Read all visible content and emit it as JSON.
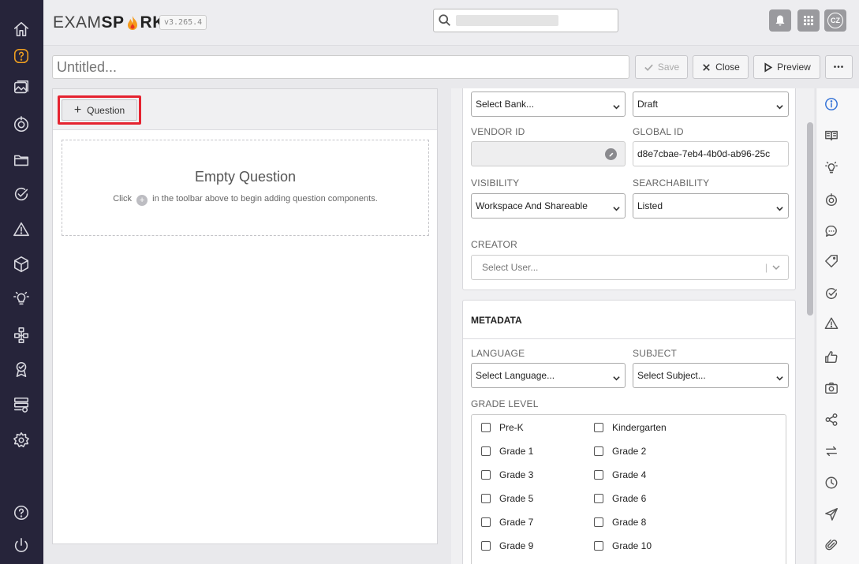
{
  "app": {
    "logo_left": "EXAM",
    "logo_bold_a": "SP",
    "logo_bold_b": "RK",
    "version": "v3.265.4",
    "user_initials": "CZ"
  },
  "search": {
    "placeholder": ""
  },
  "editor": {
    "title_placeholder": "Untitled...",
    "save_label": "Save",
    "close_label": "Close",
    "preview_label": "Preview",
    "more_label": "•••"
  },
  "question_panel": {
    "add_question_label": "Question",
    "empty_title": "Empty Question",
    "empty_hint_before": "Click",
    "empty_hint_after": "in the toolbar above to begin adding question components."
  },
  "properties": {
    "bank_value": "Select Bank...",
    "status_value": "Draft",
    "vendor_id_label": "VENDOR ID",
    "vendor_id_value": "",
    "global_id_label": "GLOBAL ID",
    "global_id_value": "d8e7cbae-7eb4-4b0d-ab96-25c",
    "visibility_label": "VISIBILITY",
    "visibility_value": "Workspace And Shareable",
    "searchability_label": "SEARCHABILITY",
    "searchability_value": "Listed",
    "creator_label": "CREATOR",
    "creator_placeholder": "Select User..."
  },
  "metadata": {
    "header": "METADATA",
    "language_label": "LANGUAGE",
    "language_value": "Select Language...",
    "subject_label": "SUBJECT",
    "subject_value": "Select Subject...",
    "grade_level_label": "GRADE LEVEL",
    "grades": [
      "Pre-K",
      "Kindergarten",
      "Grade 1",
      "Grade 2",
      "Grade 3",
      "Grade 4",
      "Grade 5",
      "Grade 6",
      "Grade 7",
      "Grade 8",
      "Grade 9",
      "Grade 10"
    ]
  },
  "colors": {
    "sidebar": "#26243a",
    "active_icon": "#f0a020",
    "highlight": "#e52330",
    "rail_active": "#2f6fd6"
  }
}
